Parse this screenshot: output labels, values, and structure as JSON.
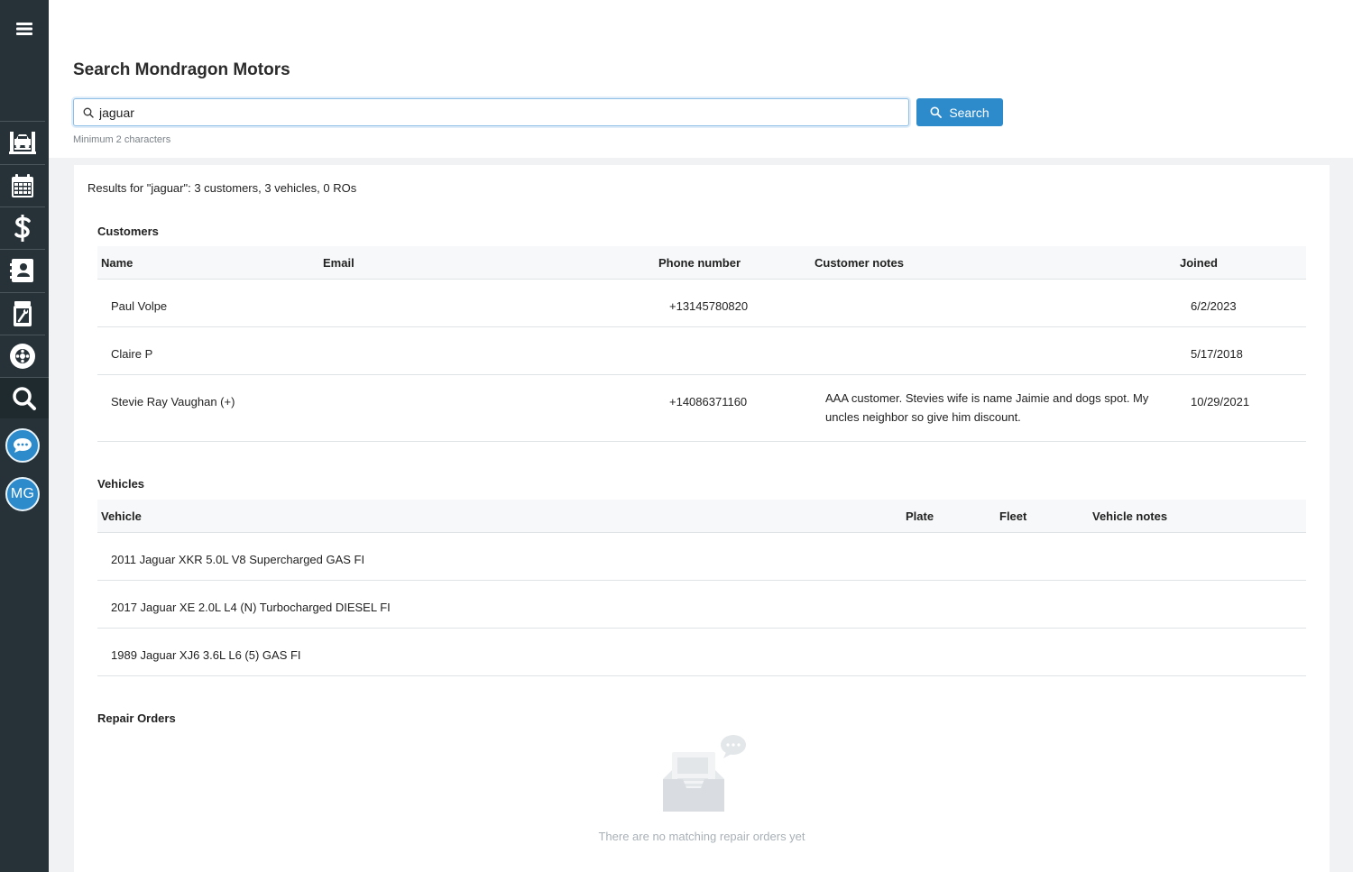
{
  "sidebar": {
    "menu_icon": "hamburger-icon",
    "items": [
      {
        "name": "service-bay",
        "icon": "car-lift-icon"
      },
      {
        "name": "calendar",
        "icon": "calendar-icon"
      },
      {
        "name": "payments",
        "icon": "dollar-icon"
      },
      {
        "name": "contacts",
        "icon": "contact-card-icon"
      },
      {
        "name": "parts",
        "icon": "oil-can-wrench-icon"
      },
      {
        "name": "tires",
        "icon": "tire-icon"
      },
      {
        "name": "search",
        "icon": "search-icon",
        "active": true
      }
    ],
    "chat_icon": "chat-bubble-icon",
    "avatar_initials": "MG"
  },
  "header": {
    "title": "Search Mondragon Motors",
    "search": {
      "value": "jaguar",
      "placeholder": ""
    },
    "search_button": "Search",
    "hint": "Minimum 2 characters"
  },
  "results": {
    "summary": "Results for \"jaguar\": 3 customers, 3 vehicles, 0 ROs",
    "customers": {
      "title": "Customers",
      "columns": [
        "Name",
        "Email",
        "Phone number",
        "Customer notes",
        "Joined"
      ],
      "rows": [
        {
          "name": "Paul Volpe",
          "email": "",
          "phone": "+13145780820",
          "notes": "",
          "joined": "6/2/2023"
        },
        {
          "name": "Claire P",
          "email": "",
          "phone": "",
          "notes": "",
          "joined": "5/17/2018"
        },
        {
          "name": "Stevie Ray Vaughan (+)",
          "email": "",
          "phone": "+14086371160",
          "notes": "AAA customer. Stevies wife is name Jaimie and dogs spot. My uncles neighbor so give him discount.",
          "joined": "10/29/2021"
        }
      ]
    },
    "vehicles": {
      "title": "Vehicles",
      "columns": [
        "Vehicle",
        "Plate",
        "Fleet",
        "Vehicle notes"
      ],
      "rows": [
        {
          "vehicle": "2011 Jaguar XKR 5.0L V8 Supercharged GAS FI",
          "plate": "",
          "fleet": "",
          "notes": ""
        },
        {
          "vehicle": "2017 Jaguar XE 2.0L L4 (N) Turbocharged DIESEL FI",
          "plate": "",
          "fleet": "",
          "notes": ""
        },
        {
          "vehicle": "1989 Jaguar XJ6 3.6L L6 (5) GAS FI",
          "plate": "",
          "fleet": "",
          "notes": ""
        }
      ]
    },
    "repair_orders": {
      "title": "Repair Orders",
      "empty_icon": "empty-inbox-icon",
      "empty_text": "There are no matching repair orders yet"
    }
  },
  "colors": {
    "sidebar_bg": "#263238",
    "accent": "#2d8bcc",
    "page_bg": "#f0f2f4"
  }
}
